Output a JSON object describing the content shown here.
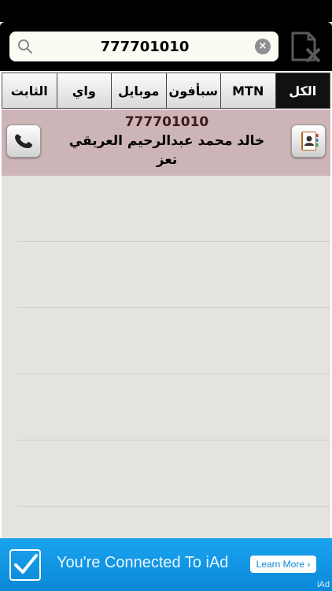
{
  "search": {
    "value": "777701010",
    "clear_icon": "x-circle-icon",
    "search_icon": "magnifier-icon",
    "delete_icon": "document-delete-icon"
  },
  "tabs": [
    {
      "label": "الكل",
      "active": true
    },
    {
      "label": "MTN",
      "active": false
    },
    {
      "label": "سبأفون",
      "active": false
    },
    {
      "label": "موبايل",
      "active": false
    },
    {
      "label": "واي",
      "active": false
    },
    {
      "label": "الثابت",
      "active": false
    }
  ],
  "results": [
    {
      "number": "777701010",
      "name": "خالد محمد عبدالرحيم العريقي",
      "city": "تعز"
    }
  ],
  "ad": {
    "text": "You're Connected To iAd",
    "button": "Learn More ›",
    "brand": "iAd"
  },
  "colors": {
    "row_highlight": "#cdb4b6",
    "list_background": "#e5e3e0",
    "active_tab": "#111111",
    "ad_blue": "#0b88d8"
  }
}
